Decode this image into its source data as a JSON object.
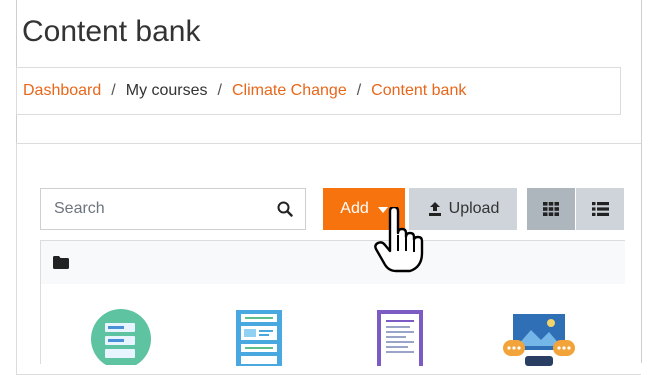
{
  "page": {
    "title": "Content bank"
  },
  "breadcrumb": {
    "items": [
      {
        "label": "Dashboard",
        "link": true
      },
      {
        "label": "My courses",
        "link": false
      },
      {
        "label": "Climate Change",
        "link": true
      },
      {
        "label": "Content bank",
        "link": true
      }
    ],
    "separator": "/"
  },
  "toolbar": {
    "search": {
      "placeholder": "Search",
      "value": ""
    },
    "add_label": "Add",
    "upload_label": "Upload"
  },
  "icons": {
    "search": "search-icon",
    "upload": "upload-icon",
    "grid": "grid-view-icon",
    "list": "list-view-icon",
    "folder": "folder-icon"
  },
  "colors": {
    "accent": "#f7730e",
    "link": "#e8671b",
    "button_secondary": "#ced4da",
    "button_active": "#adb5bd"
  },
  "files": [
    {
      "icon": "form-content-icon"
    },
    {
      "icon": "layout-content-icon"
    },
    {
      "icon": "document-content-icon"
    },
    {
      "icon": "image-chat-content-icon"
    }
  ]
}
